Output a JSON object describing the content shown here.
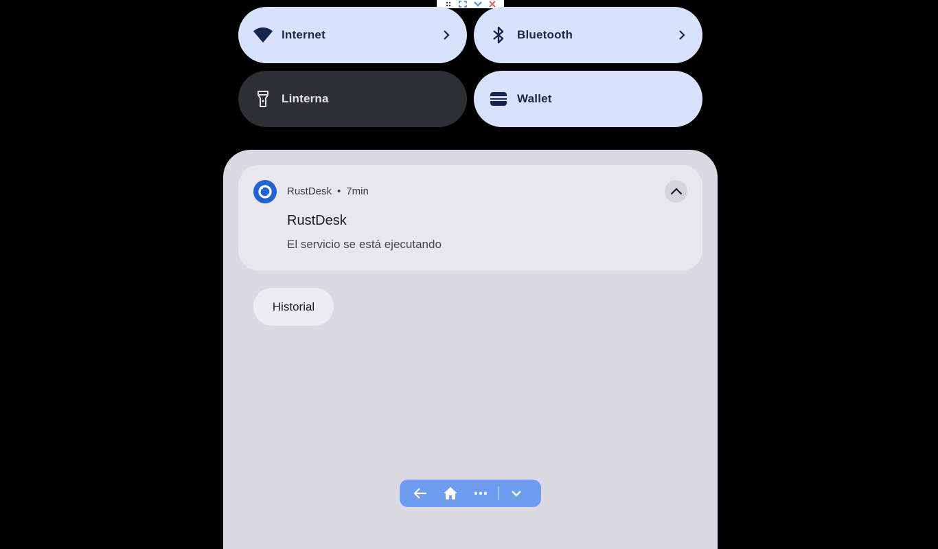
{
  "quick_settings": {
    "internet": {
      "label": "Internet",
      "icon": "wifi-icon",
      "state": "on"
    },
    "bluetooth": {
      "label": "Bluetooth",
      "icon": "bluetooth-icon",
      "state": "on"
    },
    "linterna": {
      "label": "Linterna",
      "icon": "flashlight-icon",
      "state": "off"
    },
    "wallet": {
      "label": "Wallet",
      "icon": "wallet-icon",
      "state": "on"
    }
  },
  "notification": {
    "app_name": "RustDesk",
    "separator": "•",
    "time": "7min",
    "title": "RustDesk",
    "body": "El servicio se está ejecutando"
  },
  "history_button": {
    "label": "Historial"
  },
  "colors": {
    "tile_on": "#d9e2fd",
    "tile_off": "#2e2f32",
    "shade_bg": "#dadae0",
    "navbar": "#6d9cf1",
    "app_icon": "#1f63d6"
  }
}
